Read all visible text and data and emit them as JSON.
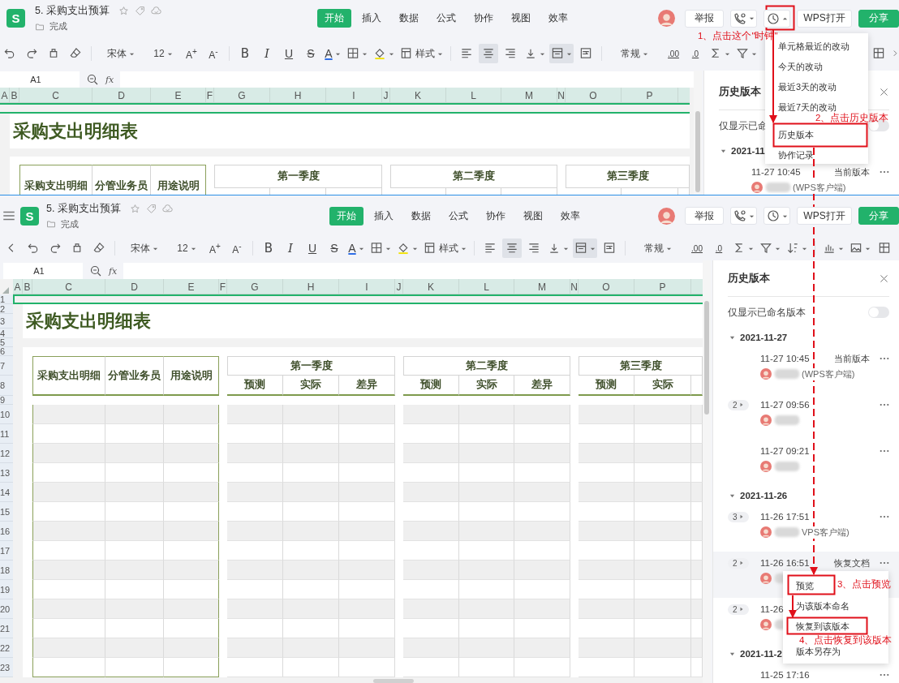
{
  "screens": [
    {
      "header": {
        "logo": "S",
        "title": "5. 采购支出预算",
        "folder": "完成",
        "tabs": [
          {
            "label": "开始",
            "selected": true
          },
          {
            "label": "插入",
            "selected": false
          },
          {
            "label": "数据",
            "selected": false
          },
          {
            "label": "公式",
            "selected": false
          },
          {
            "label": "协作",
            "selected": false
          },
          {
            "label": "视图",
            "selected": false
          },
          {
            "label": "效率",
            "selected": false
          }
        ],
        "report": "举报",
        "open_in": "WPS打开",
        "share": "分享"
      },
      "toolbar": {
        "font": "宋体",
        "size": "12",
        "grow": "A$^{+}$",
        "shrink": "A$^{-}$",
        "bold": "B",
        "italic": "I",
        "underline": "U",
        "strike": "S",
        "font_color": "A",
        "style": "样式",
        "align": [
          {
            "selected": false
          },
          {
            "selected": true
          },
          {
            "selected": false
          }
        ],
        "merge_selected": true,
        "number_format": "常规",
        "decimal_more": ".00",
        "decimal_less": ".0"
      },
      "formula": {
        "cell": "A1",
        "fx": "fx"
      },
      "columns": [
        "A",
        "B",
        "C",
        "D",
        "E",
        "F",
        "G",
        "H",
        "I",
        "J",
        "K",
        "L",
        "M",
        "N",
        "O",
        "P"
      ],
      "sheet": {
        "title": "采购支出明细表",
        "headers": [
          "采购支出明细",
          "分管业务员",
          "用途说明"
        ],
        "quarters": [
          {
            "label": "第一季度"
          },
          {
            "label": "第二季度"
          },
          {
            "label": "第三季度"
          }
        ]
      },
      "panel": {
        "title": "历史版本",
        "toggle": {
          "label": "仅显示已命",
          "on": false
        },
        "groups": [
          {
            "date": "2021-11",
            "expanded": true,
            "versions": [
              {
                "time": "11-27 10:45",
                "status": "当前版本",
                "user": "(WPS客户端)",
                "highlighted": false,
                "menu_button": true
              }
            ]
          }
        ]
      },
      "menu": {
        "kind": "dropdown",
        "items": [
          {
            "label": "单元格最近的改动"
          },
          {
            "label": "今天的改动"
          },
          {
            "label": "最近3天的改动"
          },
          {
            "label": "最近7天的改动"
          },
          {
            "label": "历史版本"
          },
          {
            "label": "协作记录"
          }
        ]
      }
    },
    {
      "menu_icon": true,
      "header": {
        "logo": "S",
        "title": "5. 采购支出预算",
        "folder": "完成",
        "tabs": [
          {
            "label": "开始",
            "selected": true
          },
          {
            "label": "插入",
            "selected": false
          },
          {
            "label": "数据",
            "selected": false
          },
          {
            "label": "公式",
            "selected": false
          },
          {
            "label": "协作",
            "selected": false
          },
          {
            "label": "视图",
            "selected": false
          },
          {
            "label": "效率",
            "selected": false
          }
        ],
        "report": "举报",
        "open_in": "WPS打开",
        "share": "分享"
      },
      "toolbar": {
        "font": "宋体",
        "size": "12",
        "grow": "A$^{+}$",
        "shrink": "A$^{-}$",
        "bold": "B",
        "italic": "I",
        "underline": "U",
        "strike": "S",
        "font_color": "A",
        "style": "样式",
        "align": [
          {
            "selected": false
          },
          {
            "selected": true
          },
          {
            "selected": false
          }
        ],
        "merge_selected": true,
        "number_format": "常规",
        "decimal_more": ".00",
        "decimal_less": ".0"
      },
      "formula": {
        "cell": "A1",
        "fx": "fx"
      },
      "columns": [
        "A",
        "B",
        "C",
        "D",
        "E",
        "F",
        "G",
        "H",
        "I",
        "J",
        "K",
        "L",
        "M",
        "N",
        "O",
        "P"
      ],
      "rows": [
        "1",
        "2",
        "3",
        "4",
        "5",
        "6",
        "7",
        "8",
        "9",
        "10",
        "11",
        "12",
        "13",
        "14",
        "15",
        "16",
        "17",
        "18",
        "19",
        "20",
        "21",
        "22",
        "23"
      ],
      "sheet": {
        "title": "采购支出明细表",
        "headers": [
          "采购支出明细",
          "分管业务员",
          "用途说明"
        ],
        "quarters": [
          {
            "label": "第一季度",
            "subs": [
              "预测",
              "实际",
              "差异"
            ]
          },
          {
            "label": "第二季度",
            "subs": [
              "预测",
              "实际",
              "差异"
            ]
          },
          {
            "label": "第三季度",
            "subs": [
              "预测",
              "实际"
            ]
          }
        ]
      },
      "panel": {
        "title": "历史版本",
        "toggle": {
          "label": "仅显示已命名版本",
          "on": false
        },
        "groups": [
          {
            "date": "2021-11-27",
            "expanded": true,
            "versions": [
              {
                "time": "11-27 10:45",
                "status": "当前版本",
                "user": "(WPS客户端)",
                "highlighted": false,
                "menu_button": true
              },
              {
                "count": "2",
                "time": "11-27 09:56",
                "highlighted": false,
                "menu_button": true
              },
              {
                "time": "11-27 09:21",
                "highlighted": false,
                "menu_button": true
              }
            ]
          },
          {
            "date": "2021-11-26",
            "expanded": true,
            "versions": [
              {
                "count": "3",
                "time": "11-26 17:51",
                "user": "VPS客户端)",
                "highlighted": false,
                "menu_button": true
              },
              {
                "count": "2",
                "time": "11-26 16:51",
                "status": "恢复文档",
                "highlighted": true,
                "menu_button": true
              },
              {
                "count": "2",
                "time": "11-26",
                "highlighted": false,
                "menu_button": false
              }
            ]
          },
          {
            "date": "2021-11-2",
            "expanded": true,
            "versions": [
              {
                "time": "11-25 17:16",
                "highlighted": false,
                "menu_button": true
              }
            ]
          }
        ]
      },
      "menu": {
        "kind": "context",
        "items": [
          {
            "label": "预览"
          },
          {
            "label": "为该版本命名"
          },
          {
            "label": "恢复到该版本"
          },
          {
            "label": "版本另存为"
          }
        ]
      }
    }
  ],
  "annotations": [
    "1、点击这个\"时钟\"",
    "2、点击历史版本",
    "3、点击预览",
    "4、点击恢复到该版本"
  ]
}
